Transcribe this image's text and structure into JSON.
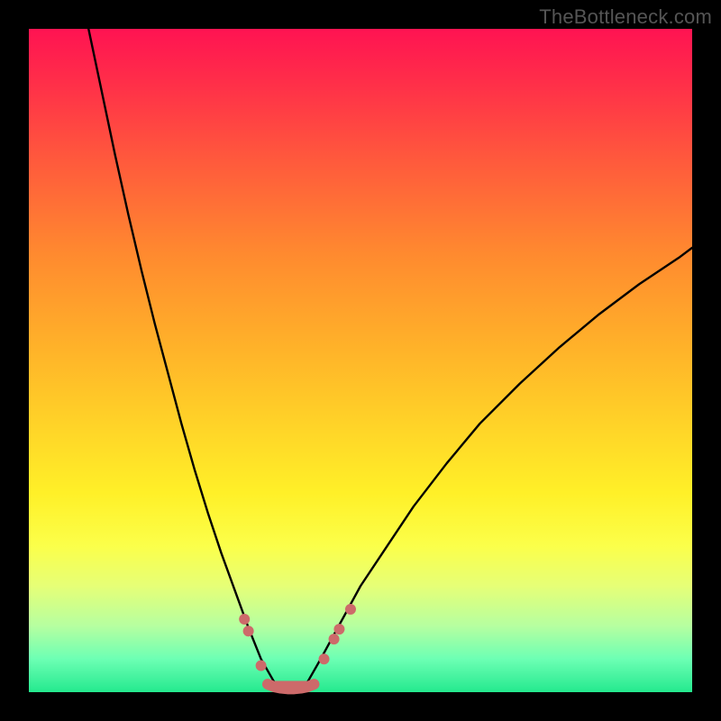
{
  "watermark": "TheBottleneck.com",
  "chart_data": {
    "type": "line",
    "title": "",
    "xlabel": "",
    "ylabel": "",
    "x_range": [
      0,
      100
    ],
    "y_range": [
      0,
      100
    ],
    "grid": false,
    "legend": false,
    "series": [
      {
        "name": "left-branch",
        "x": [
          9,
          11,
          13,
          15,
          17,
          19,
          21,
          23,
          25,
          27,
          29,
          31,
          33,
          35,
          37
        ],
        "y": [
          100,
          90.5,
          81,
          72,
          63.5,
          55.5,
          48,
          40.5,
          33.5,
          27,
          21,
          15.5,
          10,
          5,
          1.5
        ],
        "stroke": "#000000",
        "width": 2.4
      },
      {
        "name": "right-branch",
        "x": [
          42,
          44,
          47,
          50,
          54,
          58,
          63,
          68,
          74,
          80,
          86,
          92,
          98,
          100
        ],
        "y": [
          1.5,
          5,
          10.5,
          16,
          22,
          28,
          34.5,
          40.5,
          46.5,
          52,
          57,
          61.5,
          65.5,
          67
        ],
        "stroke": "#000000",
        "width": 2.4
      },
      {
        "name": "floor-segment",
        "x": [
          36,
          37,
          38,
          39,
          40,
          41,
          42,
          43
        ],
        "y": [
          1.2,
          0.8,
          0.6,
          0.5,
          0.5,
          0.6,
          0.8,
          1.2
        ],
        "stroke": "#cd6a6a",
        "width": 12
      }
    ],
    "markers": [
      {
        "name": "left-upper-dot",
        "x": 32.5,
        "y": 11.0,
        "r": 6.0,
        "fill": "#cd6a6a"
      },
      {
        "name": "left-upper-dot-2",
        "x": 33.1,
        "y": 9.2,
        "r": 6.0,
        "fill": "#cd6a6a"
      },
      {
        "name": "left-lower-dot",
        "x": 35.0,
        "y": 4.0,
        "r": 6.0,
        "fill": "#cd6a6a"
      },
      {
        "name": "right-low-dot",
        "x": 44.5,
        "y": 5.0,
        "r": 6.0,
        "fill": "#cd6a6a"
      },
      {
        "name": "right-mid-dot",
        "x": 46.0,
        "y": 8.0,
        "r": 6.0,
        "fill": "#cd6a6a"
      },
      {
        "name": "right-mid-dot-2",
        "x": 46.8,
        "y": 9.5,
        "r": 6.0,
        "fill": "#cd6a6a"
      },
      {
        "name": "right-upper-dot",
        "x": 48.5,
        "y": 12.5,
        "r": 6.0,
        "fill": "#cd6a6a"
      }
    ],
    "floor_fill": {
      "from_x": 36,
      "to_x": 43.2,
      "y": 0.4,
      "height": 1.3,
      "fill": "#cd6a6a"
    }
  }
}
